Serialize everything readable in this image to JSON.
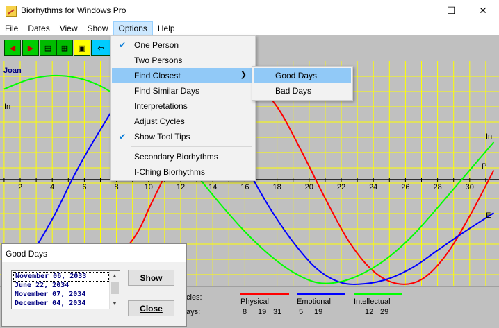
{
  "window": {
    "title": "Biorhythms for Windows Pro",
    "minimize_glyph": "—",
    "maximize_glyph": "☐",
    "close_glyph": "✕"
  },
  "menubar": [
    "File",
    "Dates",
    "View",
    "Show",
    "Options",
    "Help"
  ],
  "options_menu": {
    "items": [
      {
        "label": "One Person",
        "checked": true
      },
      {
        "label": "Two Persons",
        "checked": false
      },
      {
        "label": "Find Closest",
        "checked": false,
        "submenu": true,
        "highlighted": true
      },
      {
        "label": "Find Similar Days",
        "checked": false
      },
      {
        "label": "Interpretations",
        "checked": false
      },
      {
        "label": "Adjust Cycles",
        "checked": false
      },
      {
        "label": "Show Tool Tips",
        "checked": true
      },
      {
        "label": "Secondary Biorhythms",
        "checked": false
      },
      {
        "label": "I-Ching Biorhythms",
        "checked": false
      }
    ],
    "checkmark": "✔",
    "submenu_arrow": "❯"
  },
  "find_closest_submenu": [
    {
      "label": "Good Days",
      "highlighted": true
    },
    {
      "label": "Bad Days",
      "highlighted": false
    }
  ],
  "person": {
    "name": "Joan"
  },
  "toolbar_icons": [
    "prev-person-icon",
    "next-person-icon",
    "print-icon",
    "grid-icon",
    "calendar-icon",
    "back-arrow-icon"
  ],
  "chart_data": {
    "type": "line",
    "x_ticks": [
      2,
      4,
      6,
      8,
      10,
      12,
      14,
      16,
      18,
      20,
      22,
      24,
      26,
      28,
      30
    ],
    "x_range": [
      1,
      31.5
    ],
    "y_range": [
      -100,
      100
    ],
    "grid": true,
    "series": [
      {
        "name": "Physical",
        "abbr": "P",
        "period": 23,
        "color": "#ff0000",
        "points": [
          [
            6.5,
            -100
          ],
          [
            9,
            -58
          ],
          [
            10.2,
            -22
          ],
          [
            12,
            35
          ],
          [
            13.5,
            78
          ],
          [
            15,
            100
          ],
          [
            16.5,
            94
          ],
          [
            18,
            70
          ],
          [
            19.5,
            28
          ],
          [
            21,
            -18
          ],
          [
            22.5,
            -60
          ],
          [
            24,
            -88
          ],
          [
            25.5,
            -100
          ],
          [
            27,
            -96
          ],
          [
            28.5,
            -73
          ],
          [
            30,
            -35
          ],
          [
            31.5,
            9
          ]
        ]
      },
      {
        "name": "Emotional",
        "abbr": "E",
        "period": 28,
        "color": "#0000ff",
        "points": [
          [
            1,
            -95
          ],
          [
            2.5,
            -75
          ],
          [
            4,
            -38
          ],
          [
            5.5,
            8
          ],
          [
            7,
            48
          ],
          [
            8.5,
            83
          ],
          [
            10,
            100
          ],
          [
            11.5,
            98
          ],
          [
            13,
            80
          ],
          [
            14.5,
            52
          ],
          [
            16,
            14
          ],
          [
            17.5,
            -26
          ],
          [
            19,
            -60
          ],
          [
            20.5,
            -86
          ],
          [
            22,
            -99
          ],
          [
            23.5,
            -100
          ],
          [
            25,
            -95
          ],
          [
            26.5,
            -84
          ],
          [
            28,
            -68
          ],
          [
            29.5,
            -52
          ],
          [
            31.5,
            -32
          ]
        ]
      },
      {
        "name": "Intellectual",
        "abbr": "In",
        "period": 33,
        "color": "#00ff00",
        "points": [
          [
            1,
            87
          ],
          [
            2.5,
            96
          ],
          [
            4,
            100
          ],
          [
            5.5,
            98
          ],
          [
            7,
            90
          ],
          [
            8.5,
            75
          ],
          [
            10,
            55
          ],
          [
            11.5,
            31
          ],
          [
            13,
            4
          ],
          [
            14.5,
            -24
          ],
          [
            16,
            -50
          ],
          [
            17.5,
            -72
          ],
          [
            19,
            -89
          ],
          [
            20.5,
            -99
          ],
          [
            22,
            -98
          ],
          [
            23.5,
            -89
          ],
          [
            25,
            -74
          ],
          [
            26.5,
            -53
          ],
          [
            28,
            -27
          ],
          [
            29.5,
            0
          ],
          [
            31.5,
            36
          ]
        ]
      }
    ],
    "side_labels": {
      "left": "In",
      "right_top": "In",
      "right_mid": "P",
      "right_low": "E"
    }
  },
  "legend": {
    "row_labels": [
      "cles:",
      "ays:"
    ],
    "items": [
      {
        "name": "Physical",
        "color": "#ff0000",
        "values": [
          "8",
          "19",
          "31"
        ]
      },
      {
        "name": "Emotional",
        "color": "#0000ff",
        "values": [
          "5",
          "19"
        ]
      },
      {
        "name": "Intellectual",
        "color": "#00ff00",
        "values": [
          "12",
          "29"
        ]
      }
    ]
  },
  "good_days_dialog": {
    "title": "Good Days",
    "dates": [
      "November 06, 2033",
      "June 22, 2034",
      "November 07, 2034",
      "December 04, 2034"
    ],
    "selected_index": 0,
    "show_label": "Show",
    "close_label": "Close"
  }
}
